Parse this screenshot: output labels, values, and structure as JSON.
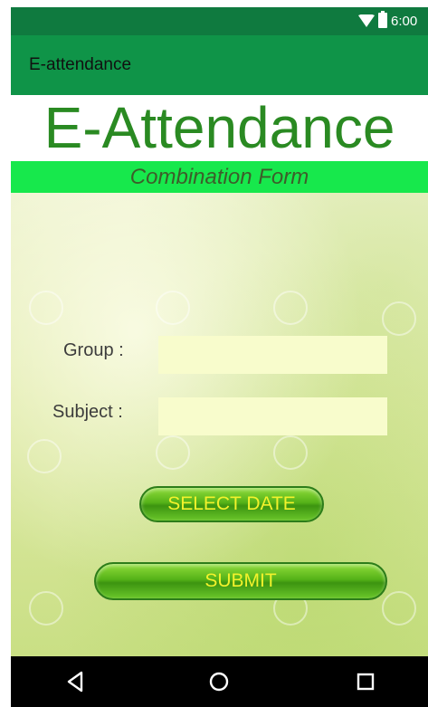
{
  "status_bar": {
    "time": "6:00"
  },
  "action_bar": {
    "title": "E-attendance"
  },
  "banner": {
    "title": "E-Attendance",
    "subtitle": "Combination Form"
  },
  "form": {
    "group_label": "Group :",
    "group_value": "",
    "subject_label": "Subject :",
    "subject_value": "",
    "select_date_label": "SELECT  DATE",
    "submit_label": "SUBMIT"
  },
  "colors": {
    "status_bar": "#0f7a3f",
    "action_bar": "#0f9448",
    "banner_text": "#2a8a22",
    "subtitle_bar": "#17e84c",
    "input_bg": "#f8fccc",
    "button_text": "#f2f22c"
  },
  "nav_bar": {
    "icons": [
      "back-icon",
      "home-icon",
      "recents-icon"
    ]
  }
}
